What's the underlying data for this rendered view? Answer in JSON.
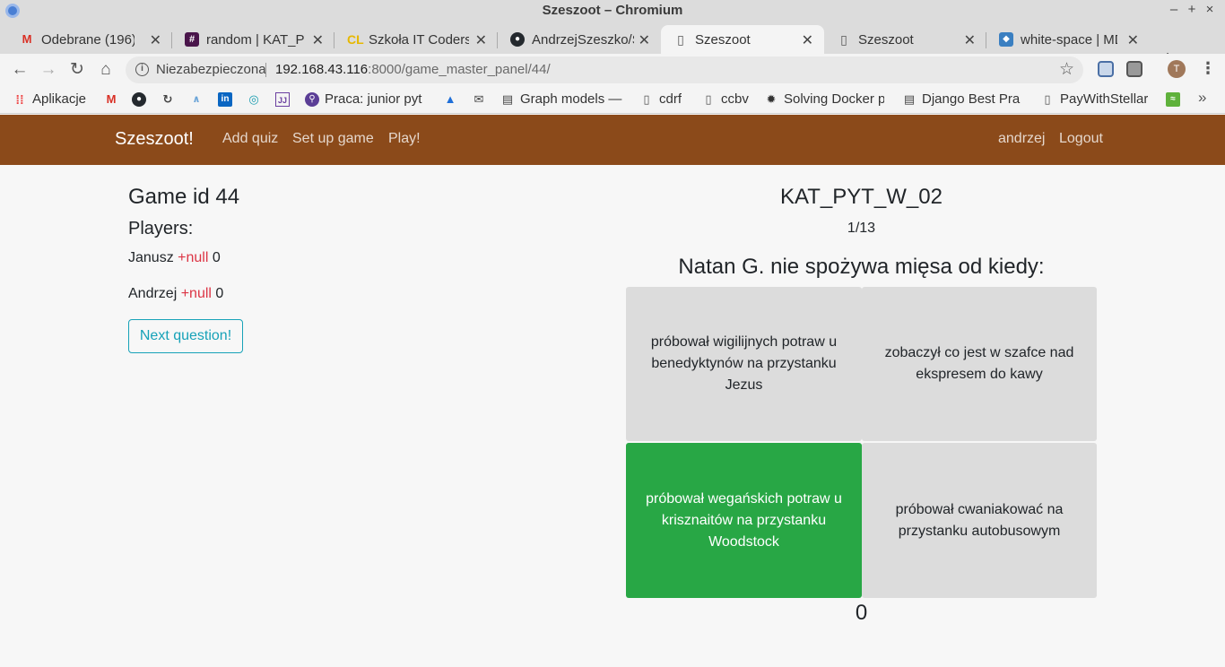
{
  "window": {
    "title": "Szeszoot – Chromium",
    "controls": [
      "–",
      "+",
      "×"
    ]
  },
  "tabs": [
    {
      "label": "Odebrane (196) -",
      "icon": "gmail-icon",
      "active": false
    },
    {
      "label": "random | KAT_PY",
      "icon": "slack-icon",
      "active": false
    },
    {
      "label": "Szkoła IT Coders",
      "icon": "coders-lab-icon",
      "active": false
    },
    {
      "label": "AndrzejSzeszko/S",
      "icon": "github-icon",
      "active": false
    },
    {
      "label": "Szeszoot",
      "icon": "page-icon",
      "active": true
    },
    {
      "label": "Szeszoot",
      "icon": "page-icon",
      "active": false
    },
    {
      "label": "white-space | MD",
      "icon": "mdn-icon",
      "active": false
    }
  ],
  "omnibox": {
    "security_label": "Niezabezpieczona",
    "url_host": "192.168.43.116",
    "url_rest": ":8000/game_master_panel/44/"
  },
  "profile": {
    "initial": "T"
  },
  "bookmarks": [
    {
      "label": "Aplikacje",
      "icon": "apps-grid-icon"
    },
    {
      "label": "",
      "icon": "gmail-icon"
    },
    {
      "label": "",
      "icon": "github-icon"
    },
    {
      "label": "",
      "icon": "sync-icon"
    },
    {
      "label": "",
      "icon": "wire-icon"
    },
    {
      "label": "",
      "icon": "linkedin-icon"
    },
    {
      "label": "",
      "icon": "target-icon"
    },
    {
      "label": "",
      "icon": "jetbrains-icon"
    },
    {
      "label": "Praca: junior pyt",
      "icon": "search-bookmark-icon"
    },
    {
      "label": "",
      "icon": "atlassian-icon"
    },
    {
      "label": "",
      "icon": "mail-icon"
    },
    {
      "label": "Graph models —",
      "icon": "doc-icon"
    },
    {
      "label": "cdrf",
      "icon": "page-icon"
    },
    {
      "label": "ccbv",
      "icon": "page-icon"
    },
    {
      "label": "Solving Docker p",
      "icon": "docker-icon"
    },
    {
      "label": "Django Best Pra",
      "icon": "doc-icon"
    },
    {
      "label": "PayWithStellar",
      "icon": "page-icon"
    },
    {
      "label": "",
      "icon": "stellar-icon"
    }
  ],
  "navbar": {
    "brand": "Szeszoot!",
    "links": [
      "Add quiz",
      "Set up game",
      "Play!"
    ],
    "user": "andrzej",
    "logout": "Logout",
    "color": "#8b4a1a"
  },
  "game": {
    "id_label": "Game id 44",
    "players_heading": "Players:",
    "players": [
      {
        "name": "Janusz",
        "delta": "+null",
        "score": "0"
      },
      {
        "name": "Andrzej",
        "delta": "+null",
        "score": "0"
      }
    ],
    "next_button": "Next question!"
  },
  "quiz": {
    "title": "KAT_PYT_W_02",
    "progress": "1/13",
    "question": "Natan G. nie spożywa mięsa od kiedy:",
    "answers": [
      {
        "text": "próbował wigilijnych potraw u benedyktynów na przystanku Jezus",
        "correct": false
      },
      {
        "text": "zobaczył co jest w szafce nad ekspresem do kawy",
        "correct": false
      },
      {
        "text": "próbował wegańskich potraw u krisznaitów na przystanku Woodstock",
        "correct": true
      },
      {
        "text": "próbował cwaniakować na przystanku autobusowym",
        "correct": false
      }
    ],
    "answer_count": "0",
    "correct_color": "#28a745",
    "default_color": "#dcdcdc"
  }
}
